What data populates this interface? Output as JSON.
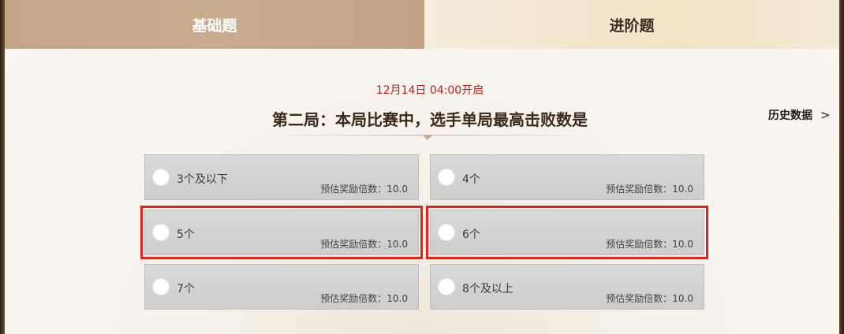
{
  "tabs": [
    {
      "label": "基础题",
      "active": true
    },
    {
      "label": "进阶题",
      "active": false
    }
  ],
  "question": {
    "open_time": "12月14日 04:00开启",
    "title": "第二局：本局比赛中，选手单局最高击败数是"
  },
  "history": {
    "label": "历史数据",
    "chevron": ">"
  },
  "reward_label": "预估奖励倍数：",
  "options": [
    {
      "label": "3个及以下",
      "reward": "10.0",
      "highlighted": false
    },
    {
      "label": "4个",
      "reward": "10.0",
      "highlighted": false
    },
    {
      "label": "5个",
      "reward": "10.0",
      "highlighted": true
    },
    {
      "label": "6个",
      "reward": "10.0",
      "highlighted": true
    },
    {
      "label": "7个",
      "reward": "10.0",
      "highlighted": false
    },
    {
      "label": "8个及以上",
      "reward": "10.0",
      "highlighted": false
    }
  ],
  "colors": {
    "accent_red": "#c8161e",
    "highlight_outline": "#e0231b",
    "active_tab": "#c6a88a"
  }
}
